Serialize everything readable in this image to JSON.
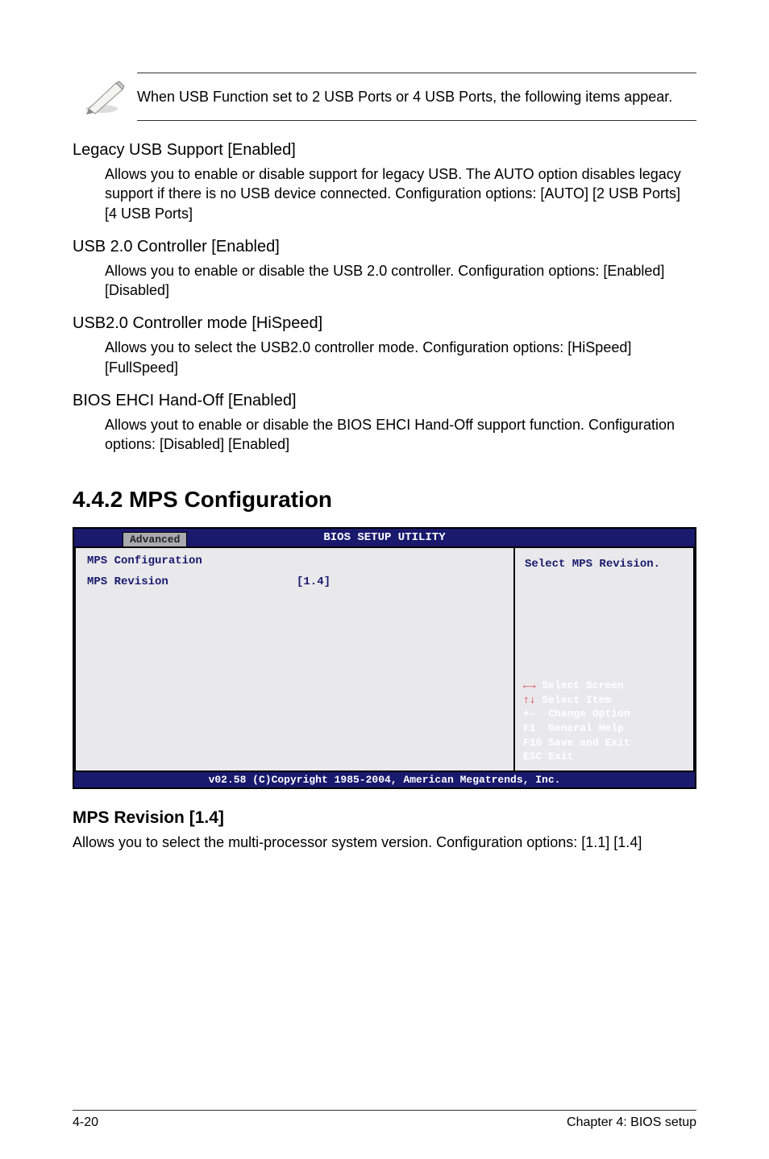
{
  "note": {
    "text": "When USB Function set to 2 USB Ports or 4 USB Ports, the following items appear."
  },
  "sections": {
    "legacy_usb": {
      "title": "Legacy USB Support [Enabled]",
      "body": "Allows you to enable or disable support for legacy USB. The AUTO option disables legacy support if there is no USB device connected. Configuration options: [AUTO] [2 USB Ports] [4 USB Ports]"
    },
    "usb20_controller": {
      "title": "USB 2.0 Controller [Enabled]",
      "body": "Allows you to enable or disable the USB 2.0 controller. Configuration options: [Enabled] [Disabled]"
    },
    "usb20_mode": {
      "title": "USB2.0 Controller mode [HiSpeed]",
      "body": "Allows you to select the USB2.0 controller mode. Configuration options: [HiSpeed] [FullSpeed]"
    },
    "bios_ehci": {
      "title": "BIOS EHCI Hand-Off [Enabled]",
      "body": "Allows yout to enable or disable the BIOS EHCI Hand-Off support function. Configuration options: [Disabled] [Enabled]"
    }
  },
  "mps_section": {
    "heading": "4.4.2 MPS Configuration",
    "subheading": "MPS Revision [1.4]",
    "subbody": "Allows you to select the multi-processor system version. Configuration options: [1.1] [1.4]"
  },
  "bios": {
    "title": "BIOS SETUP UTILITY",
    "tab": "Advanced",
    "panel_title": "MPS Configuration",
    "row1_label": "MPS Revision",
    "row1_value": "[1.4]",
    "help_top": "Select MPS Revision.",
    "hints": {
      "l1a": "←→",
      "l1b": "Select Screen",
      "l2a": "↑↓",
      "l2b": "Select Item",
      "l3a": "+-",
      "l3b": "Change Option",
      "l4a": "F1",
      "l4b": "General Help",
      "l5a": "F10",
      "l5b": "Save and Exit",
      "l6a": "ESC",
      "l6b": "Exit"
    },
    "footer": "v02.58 (C)Copyright 1985-2004, American Megatrends, Inc."
  },
  "page_footer": {
    "left": "4-20",
    "right": "Chapter 4: BIOS setup"
  }
}
